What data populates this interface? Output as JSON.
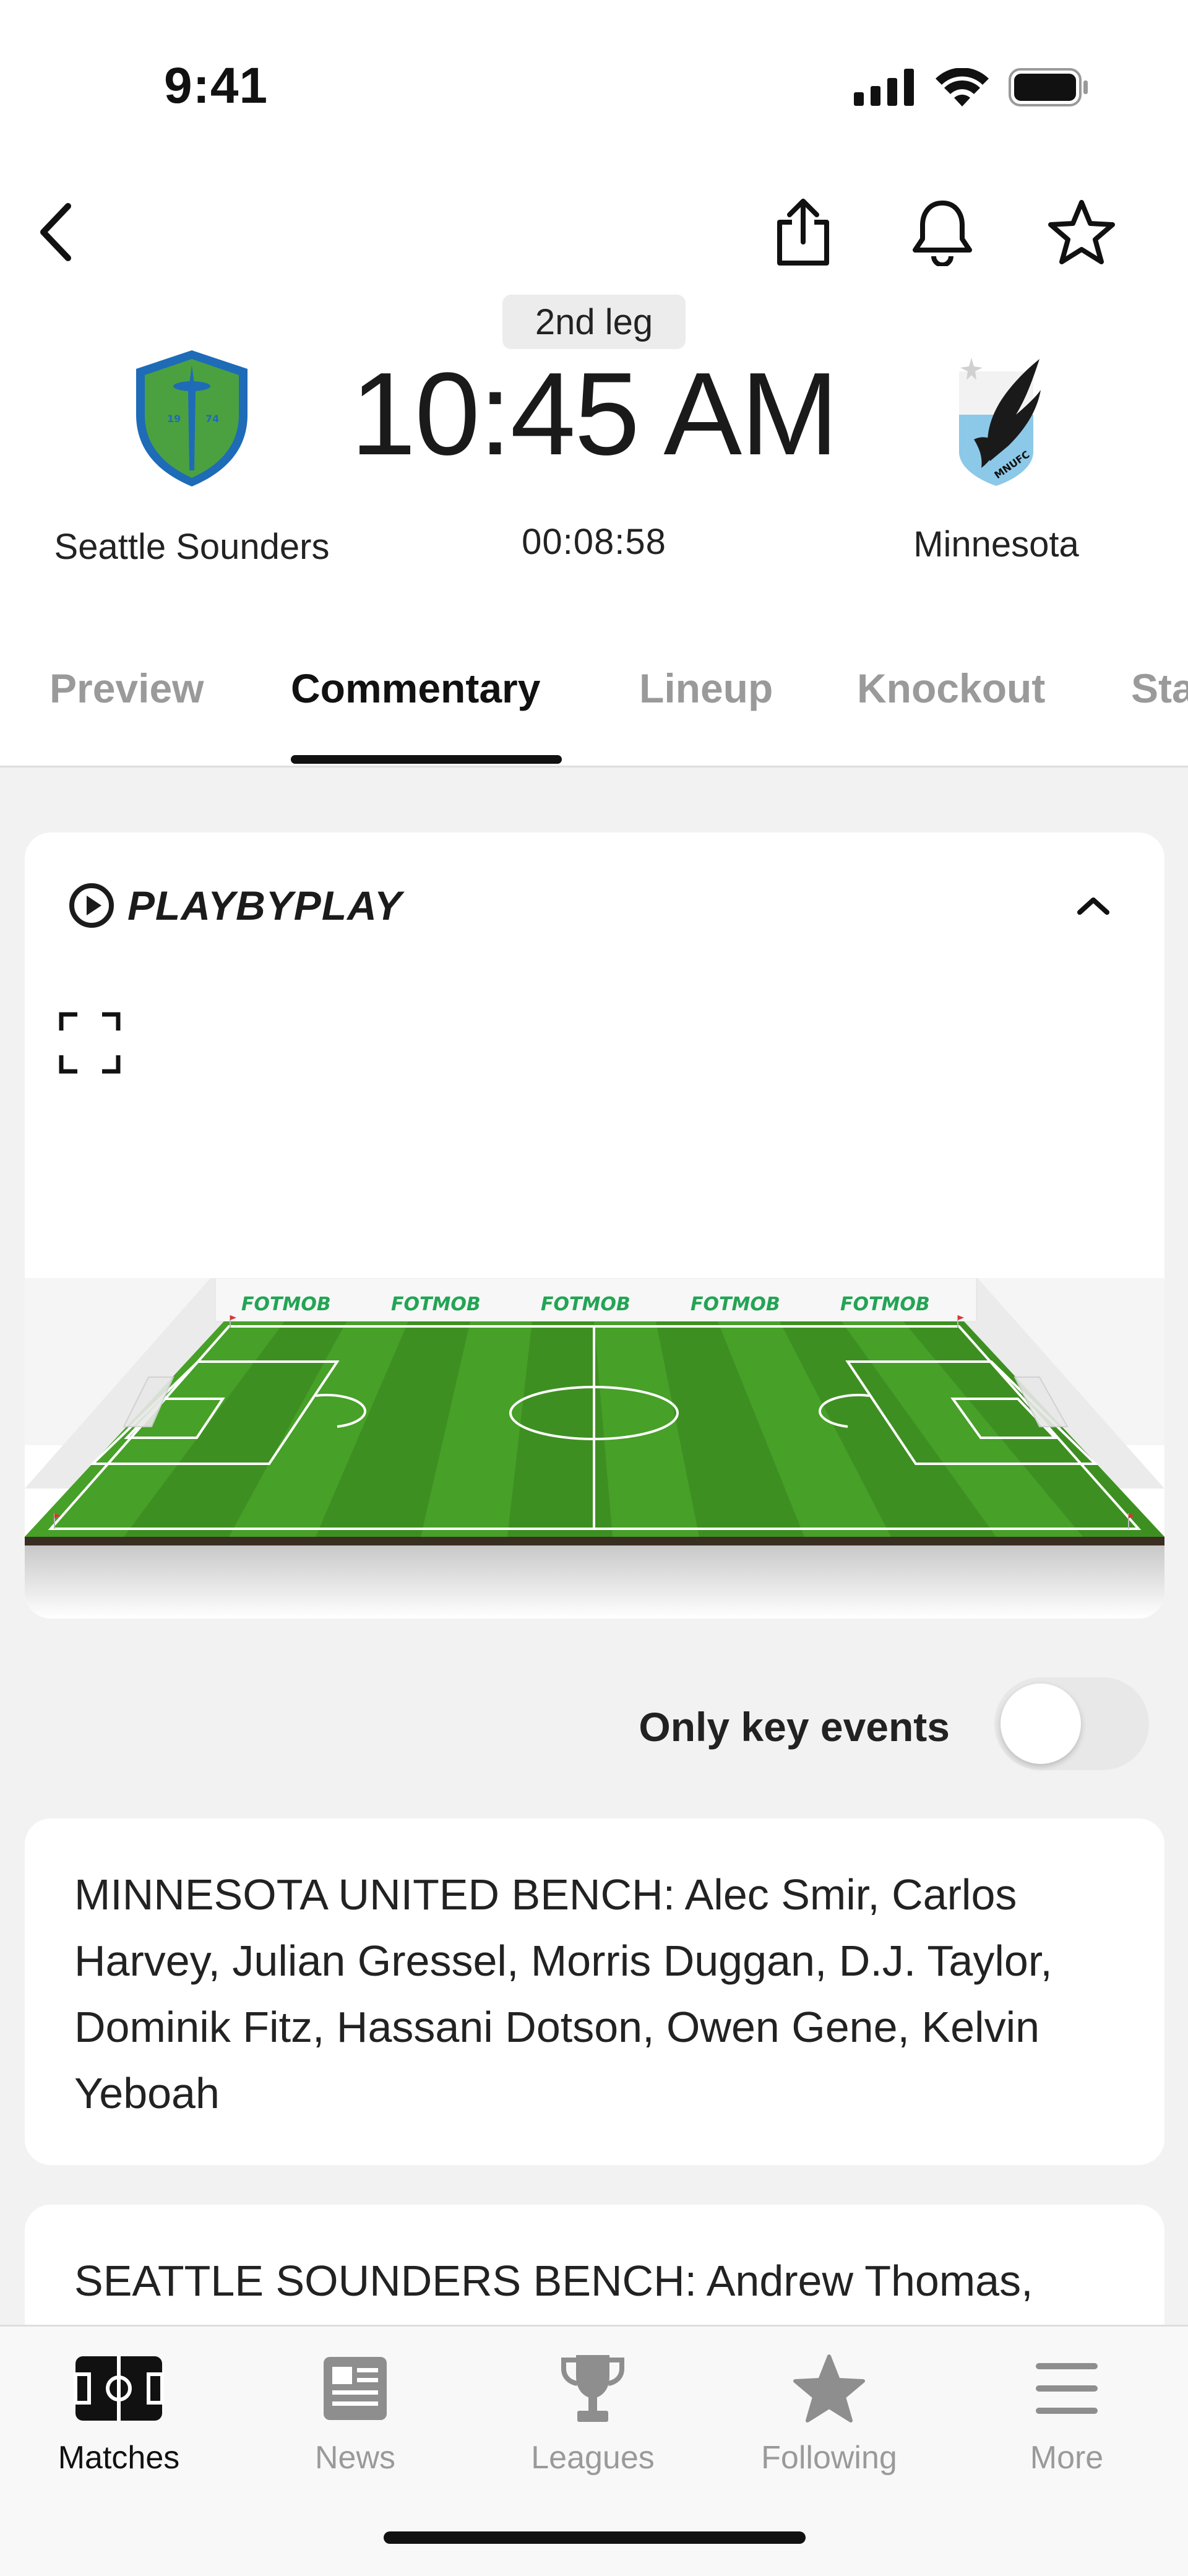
{
  "status_bar": {
    "time": "9:41"
  },
  "match": {
    "leg": "2nd leg",
    "kickoff": "10:45 AM",
    "countdown": "00:08:58",
    "home_team": "Seattle Sounders",
    "away_team": "Minnesota",
    "home_crest_text": "19 74",
    "away_crest_text": "MNUFC"
  },
  "tabs": [
    "Preview",
    "Commentary",
    "Lineup",
    "Knockout",
    "Sta"
  ],
  "active_tab": "Commentary",
  "playbyplay": {
    "title": "PLAYBYPLAY",
    "board_text": "FOTMOB"
  },
  "filter": {
    "only_key_events_label": "Only key events",
    "only_key_events_on": false
  },
  "commentary": [
    "MINNESOTA UNITED BENCH: Alec Smir, Carlos Harvey, Julian Gressel, Morris Duggan, D.J. Taylor, Dominik Fitz, Hassani Dotson, Owen Gene, Kelvin Yeboah",
    "SEATTLE SOUNDERS BENCH: Andrew Thomas,"
  ],
  "bottom_nav": [
    {
      "label": "Matches",
      "icon": "pitch-icon",
      "active": true
    },
    {
      "label": "News",
      "icon": "news-icon",
      "active": false
    },
    {
      "label": "Leagues",
      "icon": "trophy-icon",
      "active": false
    },
    {
      "label": "Following",
      "icon": "star-icon",
      "active": false
    },
    {
      "label": "More",
      "icon": "menu-icon",
      "active": false
    }
  ],
  "colors": {
    "sounders_green": "#4ba13f",
    "sounders_blue": "#1e6bb8",
    "pitch_green": "#3e8f21",
    "fotmob_green": "#23a455"
  }
}
